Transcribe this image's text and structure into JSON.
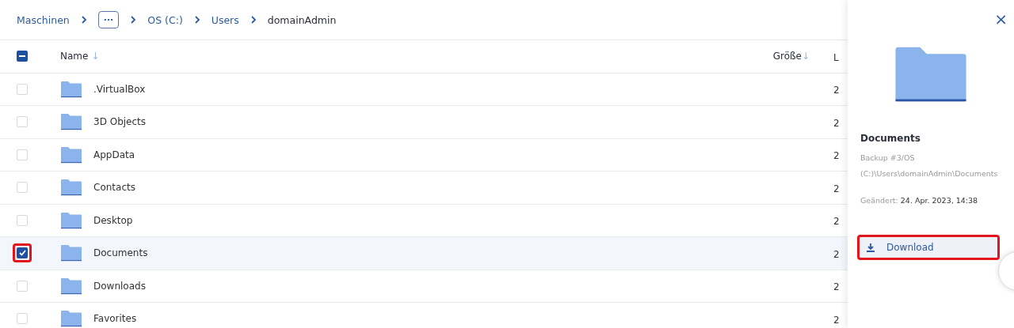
{
  "breadcrumbs": [
    {
      "kind": "link",
      "label": "Maschinen"
    },
    {
      "kind": "more",
      "label": "···"
    },
    {
      "kind": "link",
      "label": "OS (C:)"
    },
    {
      "kind": "link",
      "label": "Users"
    },
    {
      "kind": "current",
      "label": "domainAdmin"
    }
  ],
  "table": {
    "select_all_partial": true,
    "columns": [
      {
        "label": "Name",
        "sort": "↓"
      },
      {
        "label": "Größe",
        "sort": "↓"
      },
      {
        "label": "L"
      }
    ],
    "rows": [
      {
        "name": ".VirtualBox",
        "column_3": "2",
        "checked": false,
        "selected": false,
        "highlighted": false
      },
      {
        "name": "3D Objects",
        "column_3": "2",
        "checked": false,
        "selected": false,
        "highlighted": false
      },
      {
        "name": "AppData",
        "column_3": "2",
        "checked": false,
        "selected": false,
        "highlighted": false
      },
      {
        "name": "Contacts",
        "column_3": "2",
        "checked": false,
        "selected": false,
        "highlighted": false
      },
      {
        "name": "Desktop",
        "column_3": "2",
        "checked": false,
        "selected": false,
        "highlighted": false
      },
      {
        "name": "Documents",
        "column_3": "2",
        "checked": true,
        "selected": true,
        "highlighted": true
      },
      {
        "name": "Downloads",
        "column_3": "2",
        "checked": false,
        "selected": false,
        "highlighted": false
      },
      {
        "name": "Favorites",
        "column_3": "2",
        "checked": false,
        "selected": false,
        "highlighted": false
      }
    ]
  },
  "details": {
    "close": "×",
    "title": "Documents",
    "path_lines": [
      "Backup #3/OS",
      "(C:)\\Users\\domainAdmin\\Documents"
    ],
    "modified_label": "Geändert:",
    "modified_value": "24. Apr. 2023, 14:38",
    "download": {
      "label": "Download",
      "highlighted": true
    }
  }
}
